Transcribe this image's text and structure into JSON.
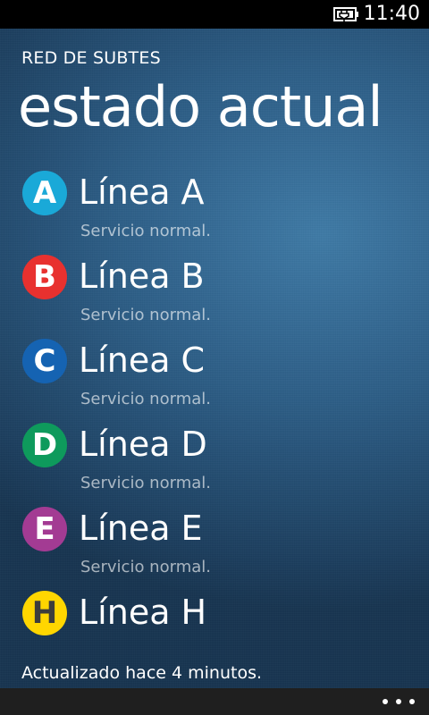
{
  "status_bar": {
    "time": "11:40",
    "battery_icon": "battery-charging-icon"
  },
  "app": {
    "title": "RED DE SUBTES",
    "page_title": "estado actual"
  },
  "lines": [
    {
      "letter": "A",
      "name": "Línea A",
      "status": "Servicio normal.",
      "color": "#1aa9d8"
    },
    {
      "letter": "B",
      "name": "Línea B",
      "status": "Servicio normal.",
      "color": "#e8312f"
    },
    {
      "letter": "C",
      "name": "Línea C",
      "status": "Servicio normal.",
      "color": "#1563b2"
    },
    {
      "letter": "D",
      "name": "Línea D",
      "status": "Servicio normal.",
      "color": "#0e9a5c"
    },
    {
      "letter": "E",
      "name": "Línea E",
      "status": "Servicio normal.",
      "color": "#a33b93"
    },
    {
      "letter": "H",
      "name": "Línea H",
      "status": "",
      "color": "#ffd600",
      "letter_color": "#3d3d3d"
    }
  ],
  "footer": {
    "updated_text": "Actualizado hace 4 minutos."
  },
  "app_bar": {
    "more_icon": "ellipsis-icon"
  }
}
